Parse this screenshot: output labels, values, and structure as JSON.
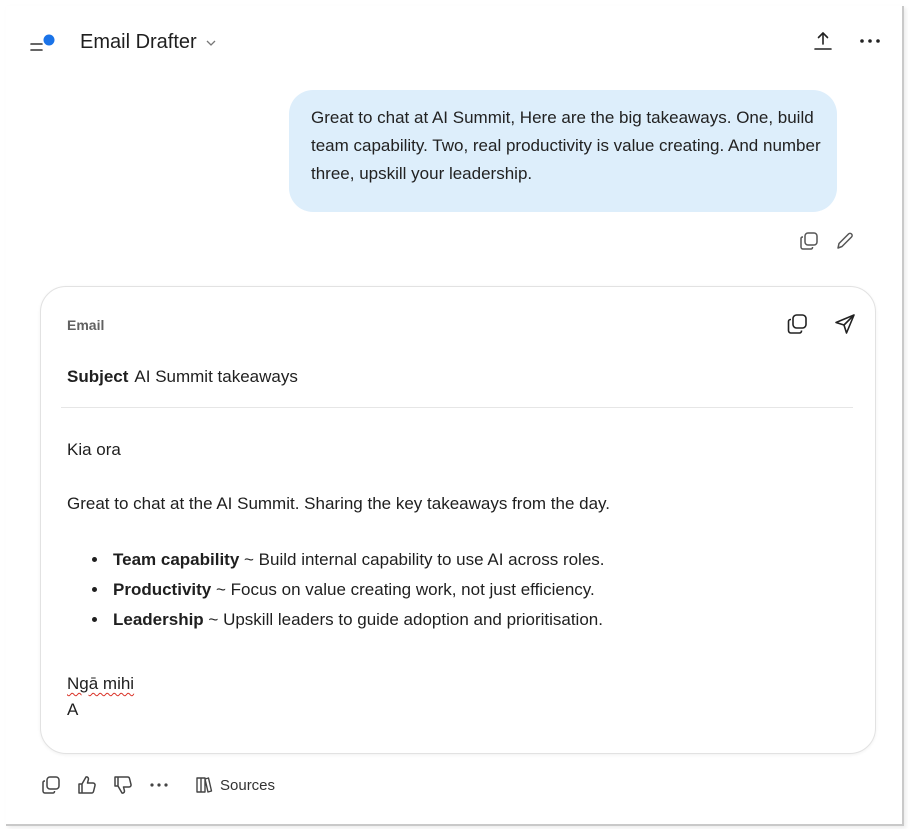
{
  "header": {
    "title": "Email Drafter",
    "menu_icon": "menu-with-dot-icon",
    "accent_dot": "#1a73e8"
  },
  "user_message": {
    "text": "Great to chat at AI Summit, Here are the big takeaways. One, build team capability. Two, real productivity is value creating.  And number three, upskill your leadership."
  },
  "email": {
    "label": "Email",
    "subject_label": "Subject",
    "subject": "AI Summit takeaways",
    "greeting": "Kia ora",
    "intro": "Great to chat at the AI Summit. Sharing the key takeaways from the day.",
    "bullets": [
      {
        "title": "Team capability",
        "text": " ~ Build internal capability to use AI across roles."
      },
      {
        "title": "Productivity",
        "text": " ~ Focus on value creating work, not just efficiency."
      },
      {
        "title": "Leadership",
        "text": " ~ Upskill leaders to guide adoption and prioritisation."
      }
    ],
    "signoff": "Ngā mihi",
    "initial": "A"
  },
  "footer": {
    "sources_label": "Sources"
  },
  "colors": {
    "bubble_bg": "#ddeefb",
    "text": "#1f1f1f",
    "spell_error": "#d93025"
  }
}
